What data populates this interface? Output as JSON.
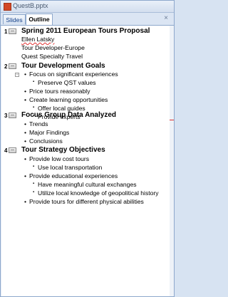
{
  "window": {
    "title": "QuestB.pptx",
    "close_glyph": "×"
  },
  "tabs": [
    {
      "label": "Slides",
      "active": false
    },
    {
      "label": "Outline",
      "active": true
    }
  ],
  "slides": [
    {
      "number": "1",
      "title": "Spring 2011 European Tours Proposal",
      "lines": [
        "Ellen Latsky",
        "Tour Developer-Europe",
        "Quest Specialty  Travel"
      ]
    },
    {
      "number": "2",
      "title": "Tour Development Goals",
      "bullets": [
        "Focus on significant  experiences",
        "Preserve QST values",
        "Price tours reasonably",
        "Create learning opportunities",
        "Offer local guides",
        "Provide experts"
      ]
    },
    {
      "number": "3",
      "title": "Focus Group Data Analyzed",
      "bullets": [
        "Trends",
        "Major Findings",
        "Conclusions"
      ]
    },
    {
      "number": "4",
      "title": "Tour Strategy Objectives",
      "bullets": [
        "Provide low cost tours",
        "Use local transportation",
        "Provide educational  experiences",
        "Have meaningful cultural exchanges",
        "Utilize local knowledge of geopolitical history",
        "Provide tours for different physical abilities"
      ]
    }
  ],
  "colors": {
    "accent": "#15428b",
    "spellcheck": "#e03030"
  }
}
